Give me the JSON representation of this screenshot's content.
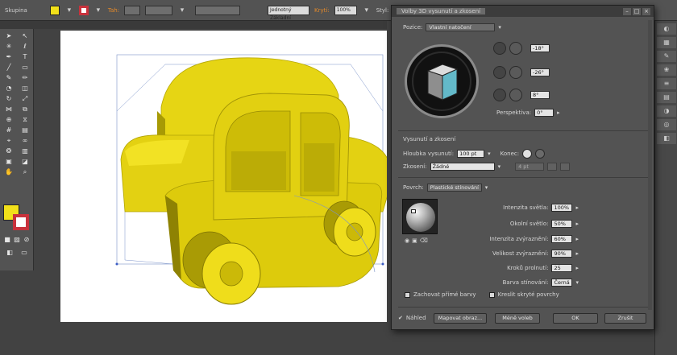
{
  "colors": {
    "fill": "#f2e01a",
    "stroke": "#c8323c",
    "car_body": "#d8c707",
    "car_light": "#f0df1c",
    "car_dark": "#9c8f04",
    "cube_face": "#63b9c9"
  },
  "controlbar": {
    "object_type": "Skupina",
    "stroke_label": "Tah:",
    "uniform_label": "Jednotný",
    "style_label": "Základní",
    "opacity_label": "Krytí:",
    "opacity_value": "100%",
    "style2_label": "Styl:"
  },
  "dialog": {
    "title": "Volby 3D vysunutí a zkosení",
    "position": {
      "label": "Pozice:",
      "value": "Vlastní natočení"
    },
    "rotation": [
      {
        "axis_icon": "x-axis-rotation-icon",
        "value": "-18°"
      },
      {
        "axis_icon": "y-axis-rotation-icon",
        "value": "-26°"
      },
      {
        "axis_icon": "z-axis-rotation-icon",
        "value": "8°"
      }
    ],
    "perspective": {
      "label": "Perspektiva:",
      "value": "0°"
    },
    "extrude_section": "Vysunutí a zkosení",
    "extrude_depth": {
      "label": "Hloubka vysunutí:",
      "value": "100 pt"
    },
    "cap": {
      "label": "Konec:"
    },
    "bevel": {
      "label": "Zkosení:",
      "value": "Žádné",
      "height_value": "4 pt"
    },
    "surface": {
      "label": "Povrch:",
      "value": "Plastické stínování"
    },
    "lighting": [
      {
        "label": "Intenzita světla:",
        "value": "100%"
      },
      {
        "label": "Okolní světlo:",
        "value": "50%"
      },
      {
        "label": "Intenzita zvýraznění:",
        "value": "60%"
      },
      {
        "label": "Velikost zvýraznění:",
        "value": "90%"
      },
      {
        "label": "Kroků prolnutí:",
        "value": "25"
      },
      {
        "label": "Barva stínování:",
        "value": "Černá"
      }
    ],
    "preserve_spot": "Zachovat přímé barvy",
    "draw_hidden": "Kreslit skryté povrchy",
    "preview_label": "Náhled",
    "buttons": {
      "map": "Mapovat obraz...",
      "fewer": "Méně voleb",
      "ok": "OK",
      "cancel": "Zrušit"
    }
  }
}
